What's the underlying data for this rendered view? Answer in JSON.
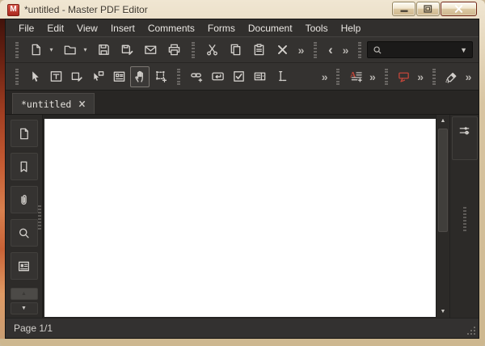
{
  "window": {
    "title": "*untitled - Master PDF Editor",
    "logo_letter": "M",
    "controls": [
      {
        "name": "minimize-button",
        "icon": "win-minimize"
      },
      {
        "name": "maximize-button",
        "icon": "win-maximize"
      },
      {
        "name": "close-button",
        "icon": "win-close"
      }
    ]
  },
  "menu": {
    "items": [
      "File",
      "Edit",
      "View",
      "Insert",
      "Comments",
      "Forms",
      "Document",
      "Tools",
      "Help"
    ]
  },
  "toolbar_main": {
    "items": [
      {
        "type": "grip",
        "name": "toolbar-grip"
      },
      {
        "type": "button",
        "name": "new-document-button",
        "icon": "new-document"
      },
      {
        "type": "caret",
        "name": "new-document-dropdown"
      },
      {
        "type": "button",
        "name": "open-document-button",
        "icon": "open-folder"
      },
      {
        "type": "caret",
        "name": "open-document-dropdown"
      },
      {
        "type": "button",
        "name": "save-button",
        "icon": "save"
      },
      {
        "type": "button",
        "name": "save-as-button",
        "icon": "save-as"
      },
      {
        "type": "button",
        "name": "send-email-button",
        "icon": "email"
      },
      {
        "type": "button",
        "name": "print-button",
        "icon": "print"
      },
      {
        "type": "grip",
        "name": "toolbar-grip"
      },
      {
        "type": "button",
        "name": "cut-button",
        "icon": "cut"
      },
      {
        "type": "button",
        "name": "copy-button",
        "icon": "copy"
      },
      {
        "type": "button",
        "name": "paste-button",
        "icon": "paste"
      },
      {
        "type": "button",
        "name": "delete-button",
        "icon": "delete"
      },
      {
        "type": "overflow",
        "name": "edit-tools-overflow"
      },
      {
        "type": "grip",
        "name": "toolbar-grip"
      },
      {
        "type": "chevleft",
        "name": "navigate-back-button"
      },
      {
        "type": "overflow",
        "name": "navigation-overflow"
      },
      {
        "type": "grip",
        "name": "toolbar-grip"
      }
    ],
    "search": {
      "value": ""
    }
  },
  "toolbar_tools": {
    "items": [
      {
        "type": "grip",
        "name": "toolbar-grip"
      },
      {
        "type": "button",
        "name": "select-tool-button",
        "icon": "select-tool"
      },
      {
        "type": "button",
        "name": "edit-text-tool-button",
        "icon": "edit-text"
      },
      {
        "type": "button",
        "name": "edit-object-tool-button",
        "icon": "edit-object"
      },
      {
        "type": "button",
        "name": "select-annotation-tool-button",
        "icon": "select-annotation"
      },
      {
        "type": "button",
        "name": "form-view-button",
        "icon": "form-view"
      },
      {
        "type": "button",
        "name": "hand-tool-button",
        "icon": "hand",
        "selected": true
      },
      {
        "type": "button",
        "name": "transform-tool-button",
        "icon": "transform"
      },
      {
        "type": "grip",
        "name": "toolbar-grip"
      },
      {
        "type": "button",
        "name": "link-tool-button",
        "icon": "link"
      },
      {
        "type": "button",
        "name": "button-field-tool-button",
        "icon": "button-field"
      },
      {
        "type": "button",
        "name": "checkbox-field-tool-button",
        "icon": "checkbox-field"
      },
      {
        "type": "button",
        "name": "combobox-field-tool-button",
        "icon": "combobox-field"
      },
      {
        "type": "button",
        "name": "text-field-tool-button",
        "icon": "text-field"
      },
      {
        "type": "spacer"
      },
      {
        "type": "overflow",
        "name": "form-tools-overflow"
      },
      {
        "type": "grip",
        "name": "toolbar-grip"
      },
      {
        "type": "button",
        "name": "add-text-comment-button",
        "icon": "add-text-comment"
      },
      {
        "type": "overflow",
        "name": "text-comment-overflow"
      },
      {
        "type": "grip",
        "name": "toolbar-grip"
      },
      {
        "type": "button",
        "name": "callout-tool-button",
        "icon": "callout"
      },
      {
        "type": "overflow",
        "name": "comment-tools-overflow"
      },
      {
        "type": "grip",
        "name": "toolbar-grip"
      },
      {
        "type": "button",
        "name": "eraser-tool-button",
        "icon": "eraser"
      },
      {
        "type": "overflow",
        "name": "markup-tools-overflow"
      }
    ]
  },
  "tab": {
    "label": "*untitled"
  },
  "sidebar": {
    "items": [
      {
        "name": "thumbnails-panel-button",
        "icon": "thumbnails-panel"
      },
      {
        "name": "bookmarks-panel-button",
        "icon": "bookmarks-panel"
      },
      {
        "name": "attachments-panel-button",
        "icon": "attachments-panel"
      },
      {
        "name": "search-panel-button",
        "icon": "search-panel"
      },
      {
        "name": "forms-panel-button",
        "icon": "forms-panel"
      }
    ]
  },
  "right_panel": {
    "properties_toggle": {
      "name": "properties-panel-button",
      "icon": "sliders"
    }
  },
  "status_bar": {
    "page_indicator": "Page 1/1"
  },
  "colors": {
    "accent_red": "#c2463a",
    "close_button_red": "#cf4a2c",
    "frame_beige": "#d8c5a2",
    "toolbar_bg": "#343230",
    "page_white": "#ffffff"
  }
}
